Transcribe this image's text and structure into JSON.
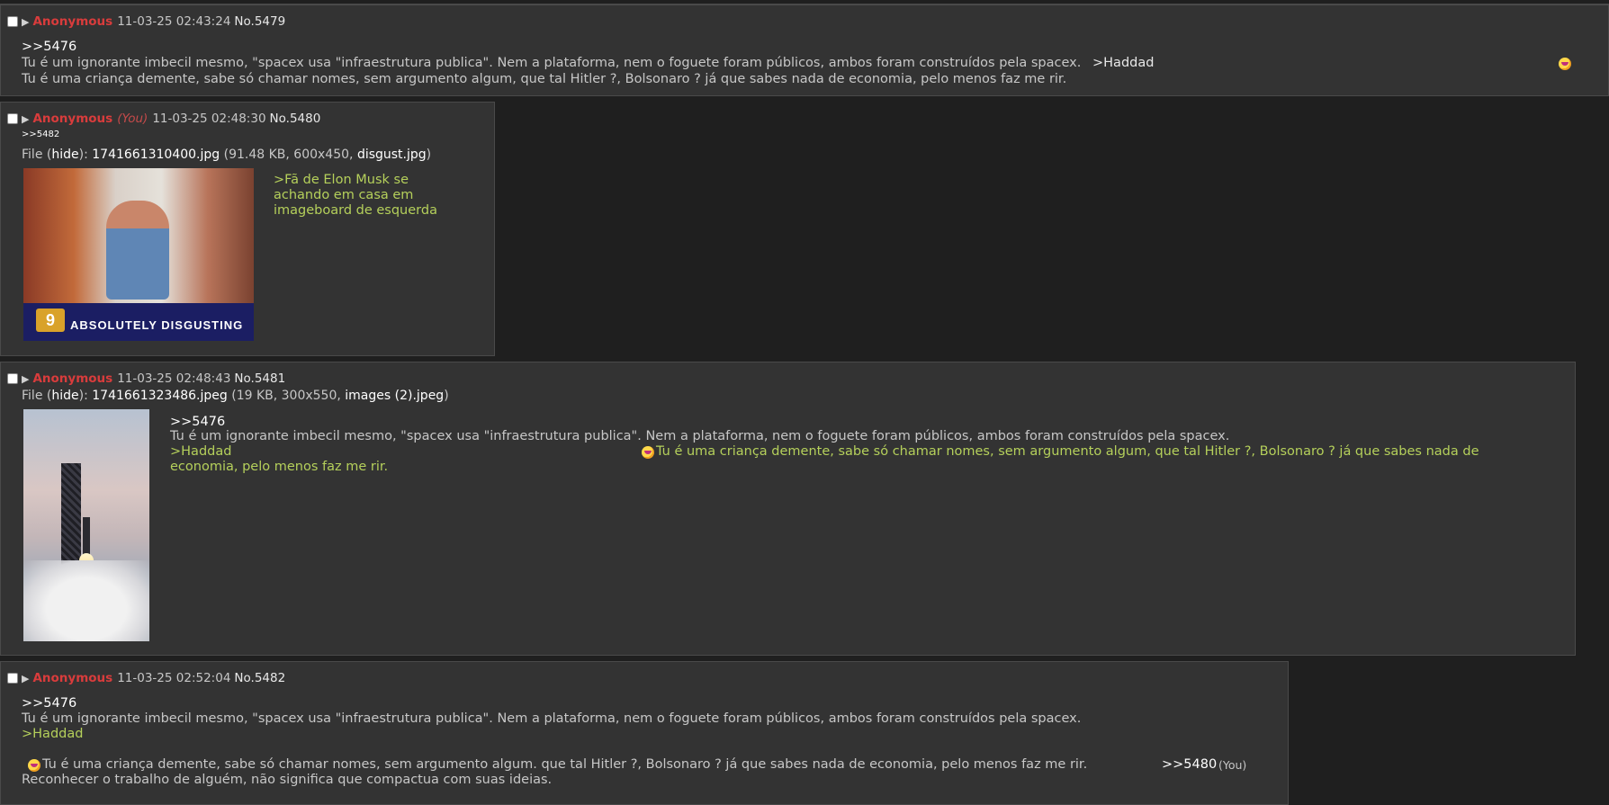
{
  "posts": [
    {
      "name": "Anonymous",
      "date": "11-03-25 02:43:24",
      "no": "No.5479",
      "lines": [
        ">>5476",
        "Tu é um ignorante imbecil mesmo, \"spacex usa \"infraestrutura publica\". Nem a plataforma, nem o foguete foram públicos, ambos foram construídos pela spacex.",
        ">Haddad",
        "Tu é uma criança demente, sabe só chamar nomes, sem argumento algum, que tal Hitler ?,  Bolsonaro  ? já que sabes nada de economia, pelo menos faz me rir."
      ]
    },
    {
      "name": "Anonymous",
      "you": "(You)",
      "date": "11-03-25 02:48:30",
      "no": "No.5480",
      "backlink": ">>5482",
      "file_label": "File (",
      "hide": "hide",
      "file_label_end": "):",
      "file_name": "1741661310400.jpg",
      "file_meta": "(91.48 KB, 600x450,",
      "orig_name": "disgust.jpg",
      "file_close": ")",
      "thumb_text": "ABSOLUTELY DISGUSTING",
      "thumb_logo": "9",
      "lines": [
        ">Fã de Elon Musk se",
        "achando em casa em",
        "imageboard de esquerda"
      ]
    },
    {
      "name": "Anonymous",
      "date": "11-03-25 02:48:43",
      "no": "No.5481",
      "file_label": "File (",
      "hide": "hide",
      "file_label_end": "):",
      "file_name": "1741661323486.jpeg",
      "file_meta": "(19 KB, 300x550,",
      "orig_name": "images (2).jpeg",
      "file_close": ")",
      "lines": [
        ">>5476",
        "Tu é um ignorante imbecil mesmo, \"spacex usa \"infraestrutura publica\". Nem a plataforma, nem o foguete foram públicos, ambos foram construídos pela spacex.",
        " >Haddad",
        " Tu é uma criança demente, sabe só chamar nomes, sem argumento algum, que tal Hitler ?, Bolsonaro  ? já que sabes nada de",
        "economia, pelo menos faz me rir."
      ]
    },
    {
      "name": "Anonymous",
      "date": "11-03-25 02:52:04",
      "no": "No.5482",
      "lines": [
        ">>5476",
        "Tu é um ignorante imbecil mesmo, \"spacex usa \"infraestrutura publica\". Nem a plataforma, nem o foguete foram públicos, ambos foram construídos pela spacex.",
        " >Haddad",
        " Tu é uma criança demente, sabe só chamar nomes, sem argumento algum. que tal Hitler ?, Bolsonaro ? já que sabes nada de economia, pelo menos faz me rir.",
        ">>5480",
        "(You)",
        "Reconhecer o trabalho de alguém, não significa que compactua com suas ideias."
      ]
    }
  ],
  "colors": {
    "name": "#d93c3c",
    "greentext": "#b5d05b",
    "post_bg": "#333333",
    "page_bg": "#1f1f1f"
  },
  "icons": [
    "checkbox-icon",
    "menu-arrow-icon",
    "emoji-rofl-icon"
  ]
}
